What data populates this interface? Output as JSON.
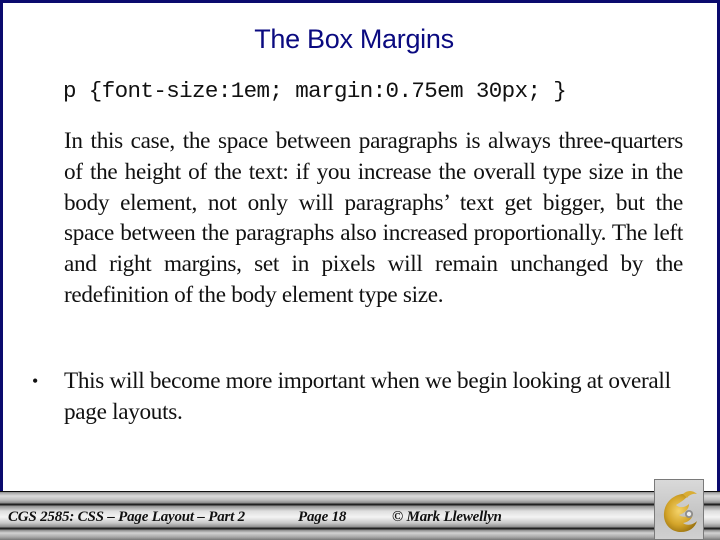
{
  "slide": {
    "title": "The Box Margins",
    "code_line": "p {font-size:1em; margin:0.75em 30px; }",
    "paragraph": "In this case, the space between paragraphs is always three-quarters of the height of the text: if you increase the overall type size in the body element, not only will paragraphs’ text get bigger, but the space between the paragraphs also increased proportionally.  The left and right margins, set in pixels will remain unchanged by the redefinition of the body element type size.",
    "bullets": [
      {
        "symbol": "•",
        "text": "This will become more important when we begin looking at overall page layouts."
      }
    ]
  },
  "footer": {
    "course": "CGS 2585: CSS – Page Layout – Part 2",
    "page": "Page 18",
    "author": "© Mark Llewellyn",
    "logo_icon": "pegasus-logo-icon"
  },
  "colors": {
    "border": "#0b0b6e",
    "title": "#0a0a80",
    "logo_gold": "#c9a227"
  }
}
